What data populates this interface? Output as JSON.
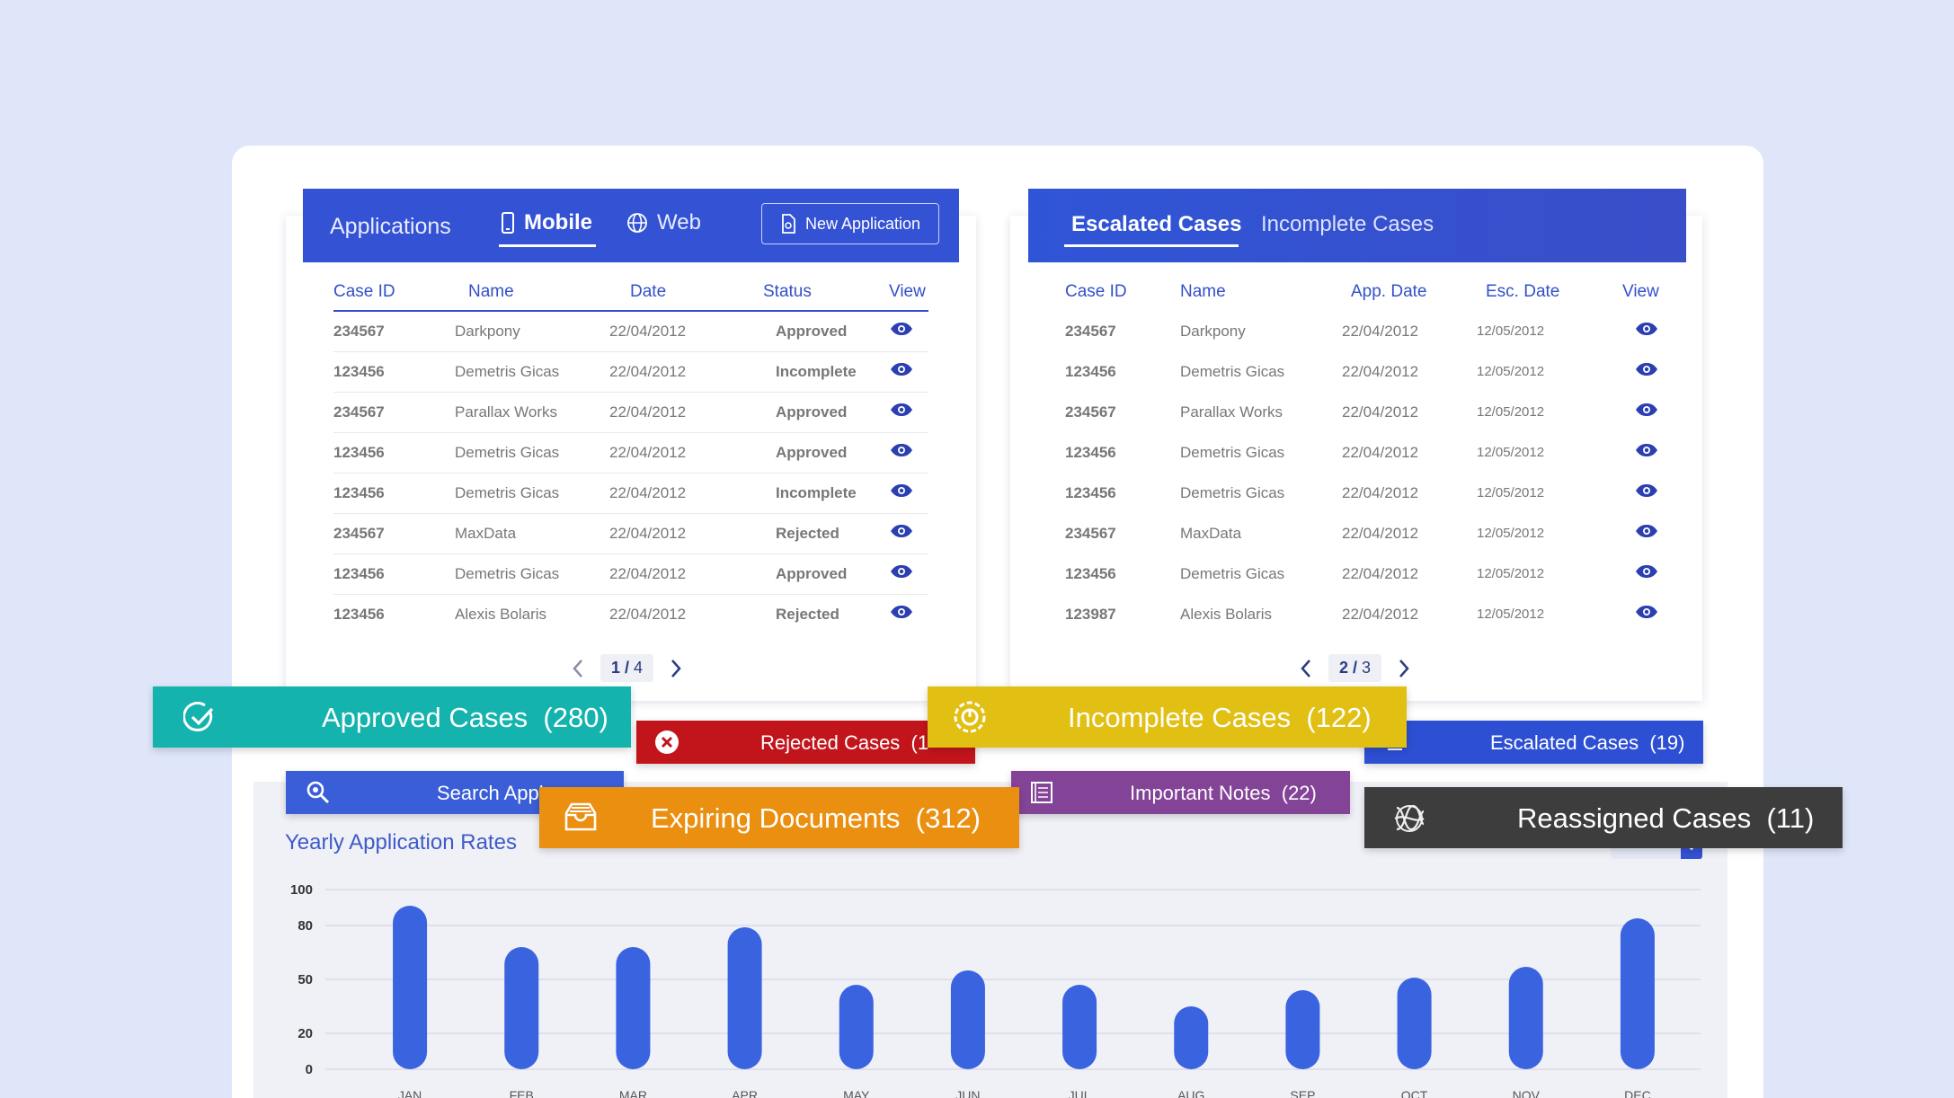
{
  "applications": {
    "title": "Applications",
    "tabs": [
      {
        "label": "Mobile",
        "active": true
      },
      {
        "label": "Web",
        "active": false
      }
    ],
    "new_button": "New Application",
    "columns": [
      "Case ID",
      "Name",
      "Date",
      "Status",
      "View"
    ],
    "rows": [
      {
        "id": "234567",
        "name": "Darkpony",
        "date": "22/04/2012",
        "status": "Approved"
      },
      {
        "id": "123456",
        "name": "Demetris Gicas",
        "date": "22/04/2012",
        "status": "Incomplete"
      },
      {
        "id": "234567",
        "name": "Parallax Works",
        "date": "22/04/2012",
        "status": "Approved"
      },
      {
        "id": "123456",
        "name": "Demetris Gicas",
        "date": "22/04/2012",
        "status": "Approved"
      },
      {
        "id": "123456",
        "name": "Demetris Gicas",
        "date": "22/04/2012",
        "status": "Incomplete"
      },
      {
        "id": "234567",
        "name": "MaxData",
        "date": "22/04/2012",
        "status": "Rejected"
      },
      {
        "id": "123456",
        "name": "Demetris Gicas",
        "date": "22/04/2012",
        "status": "Approved"
      },
      {
        "id": "123456",
        "name": "Alexis Bolaris",
        "date": "22/04/2012",
        "status": "Rejected"
      }
    ],
    "pager": {
      "current": "1",
      "total": "4"
    }
  },
  "cases": {
    "tabs": [
      {
        "label": "Escalated Cases",
        "active": true
      },
      {
        "label": "Incomplete Cases",
        "active": false
      }
    ],
    "columns": [
      "Case ID",
      "Name",
      "App. Date",
      "Esc. Date",
      "View"
    ],
    "rows": [
      {
        "id": "234567",
        "name": "Darkpony",
        "app_date": "22/04/2012",
        "esc_date": "12/05/2012"
      },
      {
        "id": "123456",
        "name": "Demetris Gicas",
        "app_date": "22/04/2012",
        "esc_date": "12/05/2012"
      },
      {
        "id": "234567",
        "name": "Parallax Works",
        "app_date": "22/04/2012",
        "esc_date": "12/05/2012"
      },
      {
        "id": "123456",
        "name": "Demetris Gicas",
        "app_date": "22/04/2012",
        "esc_date": "12/05/2012"
      },
      {
        "id": "123456",
        "name": "Demetris Gicas",
        "app_date": "22/04/2012",
        "esc_date": "12/05/2012"
      },
      {
        "id": "234567",
        "name": "MaxData",
        "app_date": "22/04/2012",
        "esc_date": "12/05/2012"
      },
      {
        "id": "123456",
        "name": "Demetris Gicas",
        "app_date": "22/04/2012",
        "esc_date": "12/05/2012"
      },
      {
        "id": "123987",
        "name": "Alexis Bolaris",
        "app_date": "22/04/2012",
        "esc_date": "12/05/2012"
      }
    ],
    "pager": {
      "current": "2",
      "total": "3"
    }
  },
  "banners": {
    "approved": {
      "label": "Approved Cases",
      "count": "(280)",
      "color": "#15b3ad",
      "icon": "check-circle-icon"
    },
    "rejected": {
      "label": "Rejected Cases",
      "count": "(1",
      "color": "#c2151b",
      "icon": "x-circle-icon"
    },
    "incomplete": {
      "label": "Incomplete Cases",
      "count": "(122)",
      "color": "#e2bf13",
      "icon": "progress-icon"
    },
    "escalated": {
      "label": "Escalated Cases",
      "count": "(19)",
      "color": "#2d4fd3",
      "icon": "escalate-icon"
    },
    "search": {
      "label": "Search Appl",
      "color": "#3a5ed7",
      "icon": "search-icon"
    },
    "expiring": {
      "label": "Expiring Documents",
      "count": "(312)",
      "color": "#ea8f0f",
      "icon": "inbox-icon"
    },
    "notes": {
      "label": "Important Notes",
      "count": "(22)",
      "color": "#834497",
      "icon": "notes-icon"
    },
    "reassigned": {
      "label": "Reassigned Cases",
      "count": "(11)",
      "color": "#3d3d3d",
      "icon": "tangle-icon"
    }
  },
  "chart_data": {
    "type": "bar",
    "title": "Yearly Application Rates",
    "year_select": "",
    "categories": [
      "JAN",
      "FEB",
      "MAR",
      "APR",
      "MAY",
      "JUN",
      "JUL",
      "AUG",
      "SEP",
      "OCT",
      "NOV",
      "DEC"
    ],
    "values": [
      91,
      68,
      68,
      79,
      47,
      55,
      47,
      35,
      44,
      51,
      57,
      84
    ],
    "y_ticks": [
      0,
      20,
      50,
      80,
      100
    ],
    "ylim": [
      0,
      100
    ],
    "grid": true,
    "bar_color": "#3a63e0"
  }
}
